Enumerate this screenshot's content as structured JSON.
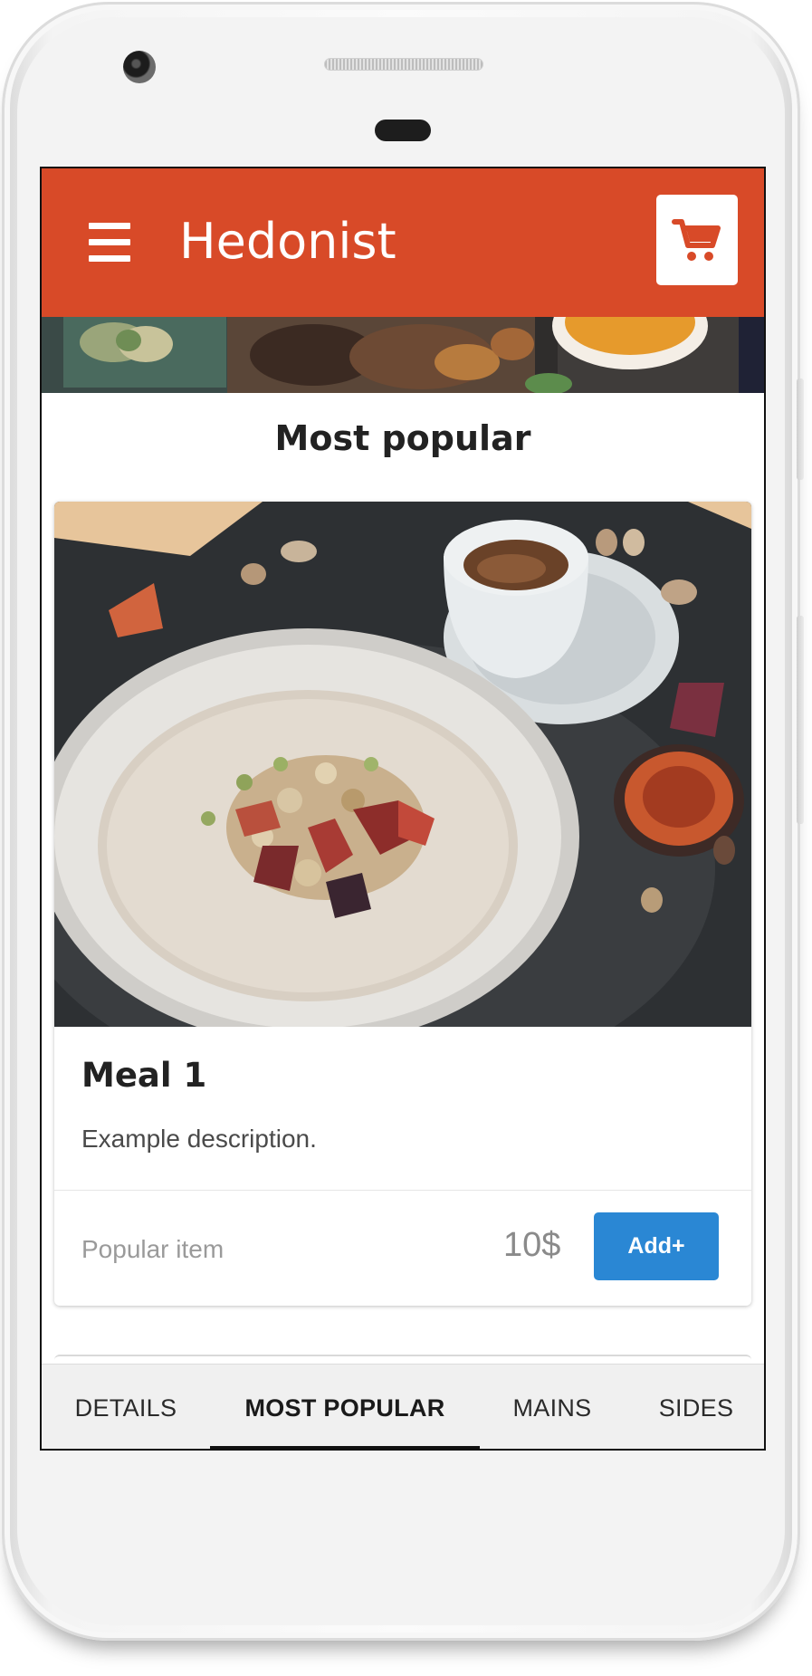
{
  "app": {
    "title": "Hedonist"
  },
  "colors": {
    "appbar": "#d84a28",
    "accent_button": "#2a87d4",
    "cart_icon": "#d84a28"
  },
  "icons": {
    "menu": "hamburger-menu-icon",
    "cart": "shopping-cart-icon"
  },
  "section": {
    "title": "Most popular"
  },
  "items": [
    {
      "name": "Meal 1",
      "description": "Example description.",
      "tag": "Popular item",
      "price": "10$",
      "add_label": "Add+"
    }
  ],
  "tabs": [
    {
      "label": "DETAILS",
      "active": false
    },
    {
      "label": "MOST POPULAR",
      "active": true
    },
    {
      "label": "MAINS",
      "active": false
    },
    {
      "label": "SIDES",
      "active": false
    }
  ]
}
